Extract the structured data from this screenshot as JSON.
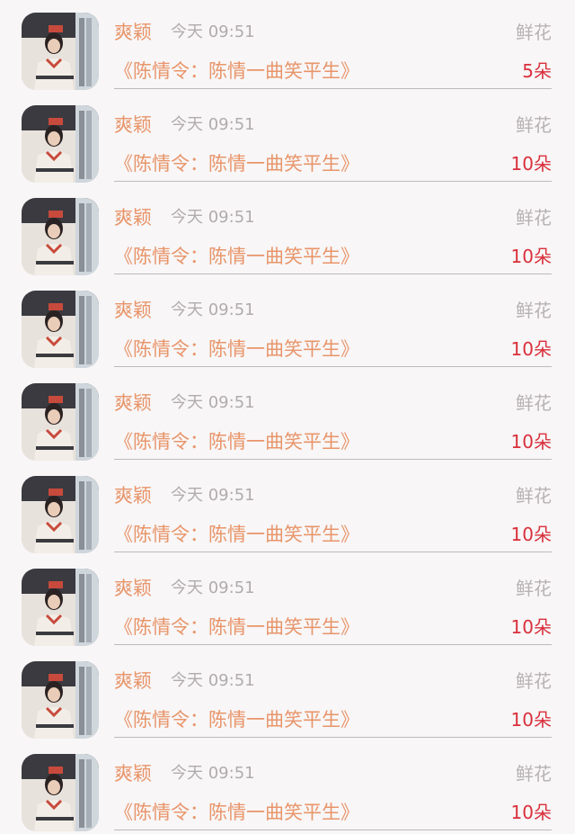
{
  "list": {
    "items": [
      {
        "name": "爽颖",
        "time": "今天 09:51",
        "gift": "鲜花",
        "work": "《陈情令：陈情一曲笑平生》",
        "count": "5朵"
      },
      {
        "name": "爽颖",
        "time": "今天 09:51",
        "gift": "鲜花",
        "work": "《陈情令：陈情一曲笑平生》",
        "count": "10朵"
      },
      {
        "name": "爽颖",
        "time": "今天 09:51",
        "gift": "鲜花",
        "work": "《陈情令：陈情一曲笑平生》",
        "count": "10朵"
      },
      {
        "name": "爽颖",
        "time": "今天 09:51",
        "gift": "鲜花",
        "work": "《陈情令：陈情一曲笑平生》",
        "count": "10朵"
      },
      {
        "name": "爽颖",
        "time": "今天 09:51",
        "gift": "鲜花",
        "work": "《陈情令：陈情一曲笑平生》",
        "count": "10朵"
      },
      {
        "name": "爽颖",
        "time": "今天 09:51",
        "gift": "鲜花",
        "work": "《陈情令：陈情一曲笑平生》",
        "count": "10朵"
      },
      {
        "name": "爽颖",
        "time": "今天 09:51",
        "gift": "鲜花",
        "work": "《陈情令：陈情一曲笑平生》",
        "count": "10朵"
      },
      {
        "name": "爽颖",
        "time": "今天 09:51",
        "gift": "鲜花",
        "work": "《陈情令：陈情一曲笑平生》",
        "count": "10朵"
      },
      {
        "name": "爽颖",
        "time": "今天 09:51",
        "gift": "鲜花",
        "work": "《陈情令：陈情一曲笑平生》",
        "count": "10朵"
      }
    ]
  },
  "colors": {
    "accent": "#e8956a",
    "count": "#d9303b",
    "muted": "#b0acae",
    "background": "#f8f6f7"
  }
}
